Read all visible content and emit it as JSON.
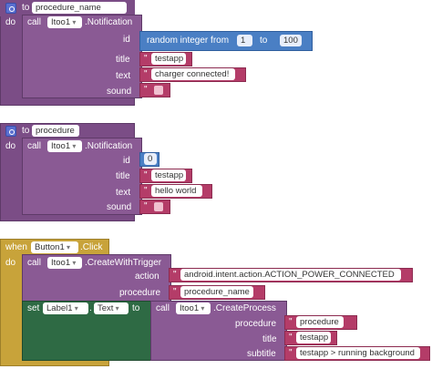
{
  "block1": {
    "to": "to",
    "proc_name": "procedure_name",
    "do": "do",
    "call": "call",
    "component": "Itoo1",
    "method": ".Notification",
    "id_label": "id",
    "random_text": "random integer from",
    "from_val": "1",
    "to_label": "to",
    "to_val": "100",
    "title_label": "title",
    "title_val": "testapp",
    "text_label": "text",
    "text_val": "charger connected!",
    "sound_label": "sound"
  },
  "block2": {
    "to": "to",
    "proc_name": "procedure",
    "do": "do",
    "call": "call",
    "component": "Itoo1",
    "method": ".Notification",
    "id_label": "id",
    "id_val": "0",
    "title_label": "title",
    "title_val": "testapp",
    "text_label": "text",
    "text_val": "hello world",
    "sound_label": "sound"
  },
  "block3": {
    "when": "when",
    "button": "Button1",
    "event": ".Click",
    "do": "do",
    "call": "call",
    "component": "Itoo1",
    "method": ".CreateWithTrigger",
    "action_label": "action",
    "action_val": "android.intent.action.ACTION_POWER_CONNECTED",
    "procedure_label": "procedure",
    "procedure_val": "procedure_name",
    "set": "set",
    "label_comp": "Label1",
    "prop": "Text",
    "to_label": "to",
    "call2": "call",
    "component2": "Itoo1",
    "method2": ".CreateProcess",
    "cp_procedure_label": "procedure",
    "cp_procedure_val": "procedure",
    "cp_title_label": "title",
    "cp_title_val": "testapp",
    "cp_subtitle_label": "subtitle",
    "cp_subtitle_val": "testapp > running background"
  },
  "colors": {
    "procedure": "#7b4d86",
    "text": "#b43c68",
    "math": "#4a7fc4",
    "event": "#c8a33a",
    "setter": "#2e6a44"
  }
}
